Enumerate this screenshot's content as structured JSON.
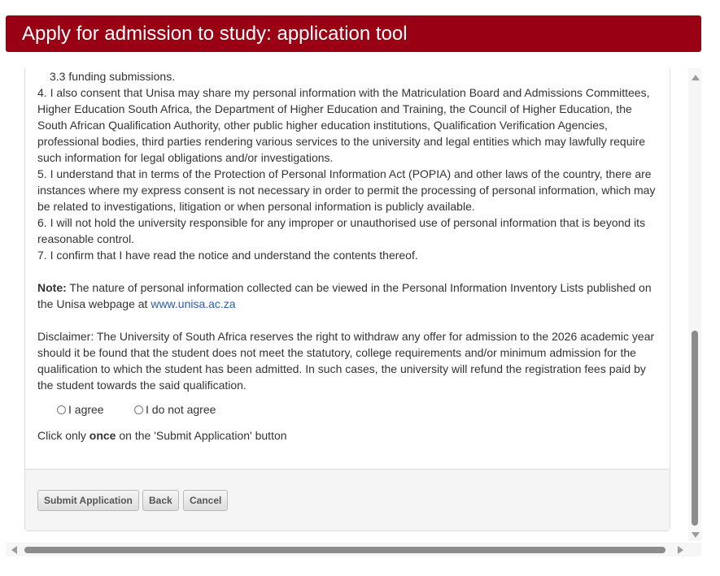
{
  "header": {
    "title": "Apply for admission to study: application tool"
  },
  "content": {
    "item_3_3": "3.3 funding submissions.",
    "item_4": "4. I also consent that Unisa may share my personal information with the Matriculation Board and Admissions Committees, Higher Education South Africa, the Department of Higher Education and Training, the Council of Higher Education, the South African Qualification Authority, other public higher education institutions, Qualification Verification Agencies, professional bodies, third parties rendering various services to the university and legal entities which may lawfully require such information for legal obligations and/or investigations.",
    "item_5": "5. I understand that in terms of the Protection of Personal Information Act (POPIA) and other laws of the country, there are instances where my express consent is not necessary in order to permit the processing of personal information, which may be related to investigations, litigation or when personal information is publicly available.",
    "item_6": "6. I will not hold the university responsible for any improper or unauthorised use of personal information that is beyond its reasonable control.",
    "item_7": "7. I confirm that I have read the notice and understand the contents thereof.",
    "note_label": "Note:",
    "note_text": " The nature of personal information collected can be viewed in the Personal Information Inventory Lists published on the Unisa webpage at ",
    "note_link": "www.unisa.ac.za",
    "disclaimer": "Disclaimer: The University of South Africa reserves the right to withdraw any offer for admission to the 2026 academic year should it be found that the student does not meet the statutory, college requirements and/or minimum admission for the qualification to which the student has been admitted. In such cases, the university will refund the registration fees paid by the student towards the said qualification.",
    "radio_agree": "I agree",
    "radio_disagree": "I do not agree",
    "click_prefix": "Click only ",
    "click_bold": "once",
    "click_suffix": " on the 'Submit Application' button"
  },
  "buttons": {
    "submit": "Submit Application",
    "back": "Back",
    "cancel": "Cancel"
  },
  "colors": {
    "header_bg": "#9a0014",
    "link": "#2a5db0"
  }
}
